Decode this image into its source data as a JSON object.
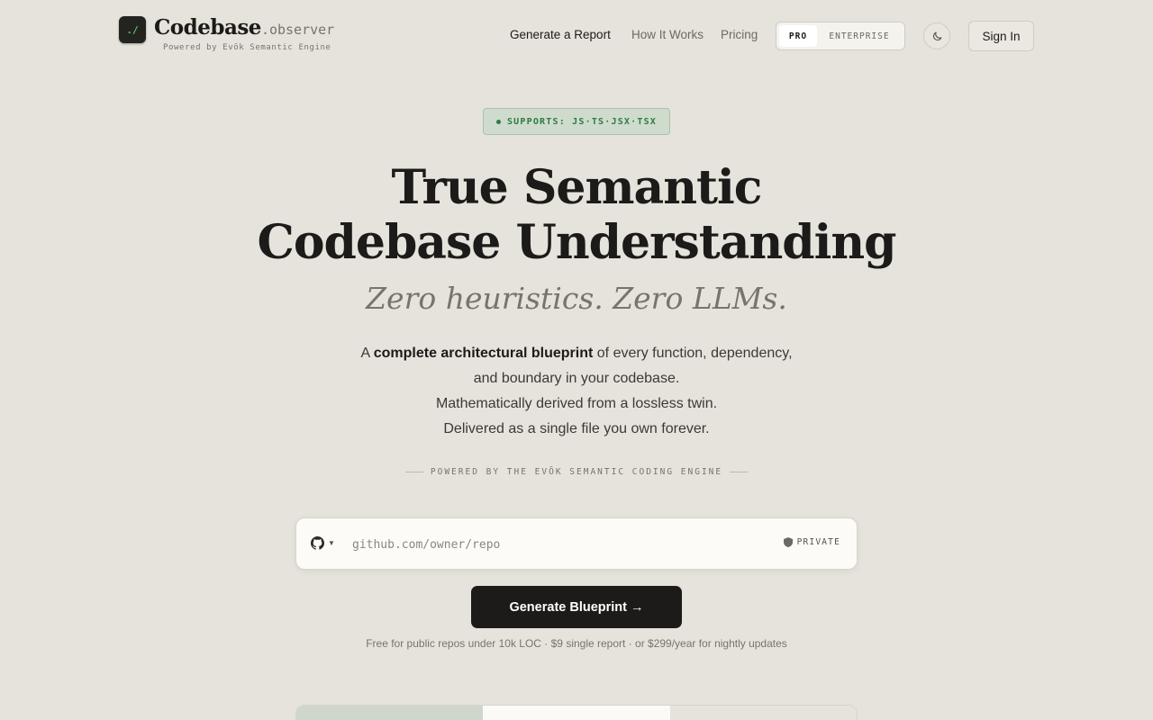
{
  "header": {
    "logo_glyph": "./",
    "brand_name": "Codebase",
    "brand_suffix": ".observer",
    "brand_sub": "Powered by Evōk Semantic Engine",
    "nav": {
      "generate": "Generate a Report",
      "how": "How It Works",
      "pricing": "Pricing"
    },
    "plans": {
      "pro": "PRO",
      "enterprise": "ENTERPRISE",
      "selected": "PRO"
    },
    "theme_icon": "moon-icon",
    "signin": "Sign In"
  },
  "hero": {
    "badge": "SUPPORTS: JS·TS·JSX·TSX",
    "title_line1": "True Semantic",
    "title_line2": "Codebase Understanding",
    "tagline": "Zero heuristics. Zero LLMs.",
    "desc_prefix": "A ",
    "desc_bold": "complete architectural blueprint",
    "desc_rest": " of every function, dependency, and boundary in your codebase.",
    "desc_line3": "Mathematically derived from a lossless twin.",
    "desc_line4": "Delivered as a single file you own forever.",
    "powered": "POWERED BY THE EVŌK SEMANTIC CODING ENGINE"
  },
  "repo": {
    "provider_icon": "github-icon",
    "placeholder": "github.com/owner/repo",
    "value": "",
    "private_label": "PRIVATE"
  },
  "cta": {
    "generate": "Generate Blueprint →",
    "pricing_note": "Free for public repos under 10k LOC · $9 single report · or $299/year for nightly updates"
  },
  "colors": {
    "background": "#e6e3dc",
    "ink": "#1c1b19",
    "accent_green": "#2f7a45",
    "muted": "#77746e"
  }
}
